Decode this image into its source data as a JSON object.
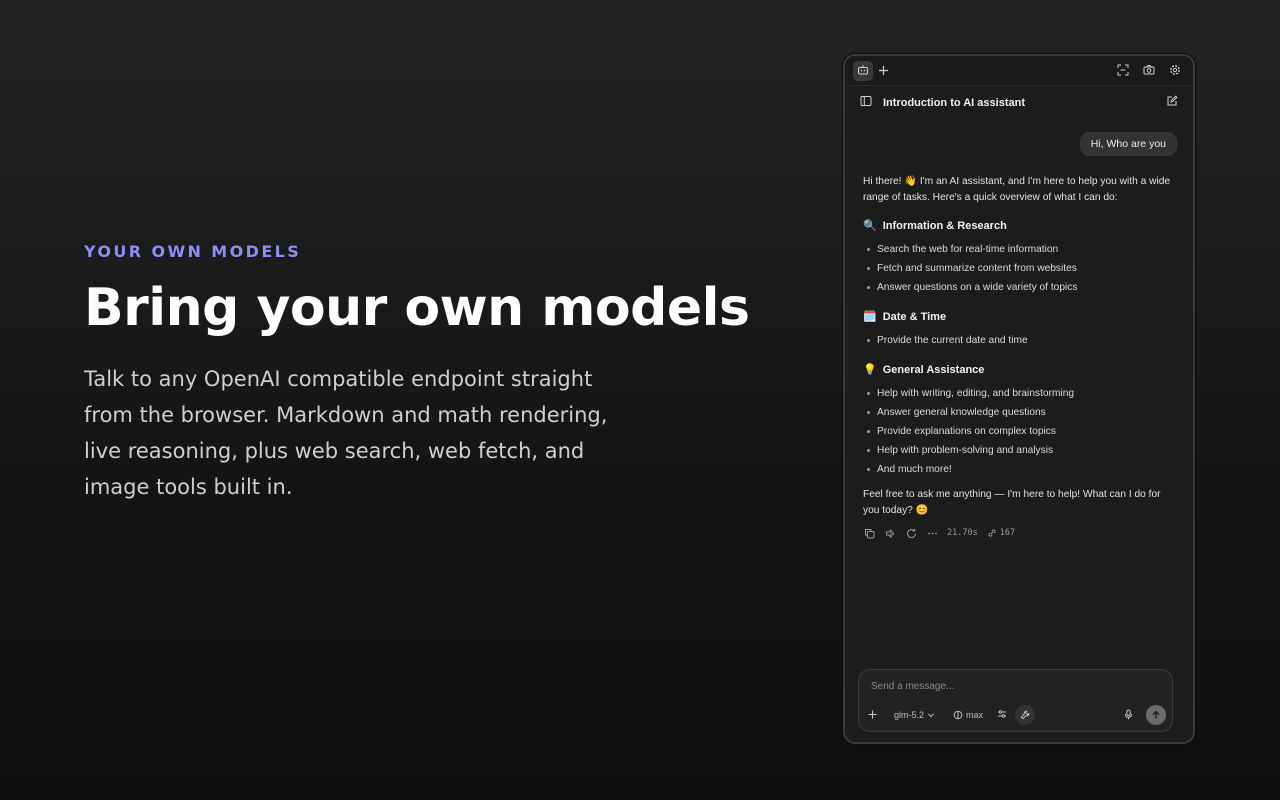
{
  "hero": {
    "eyebrow": "YOUR OWN MODELS",
    "headline": "Bring your own models",
    "description": "Talk to any OpenAI compatible endpoint straight from the browser. Markdown and math rendering, live reasoning, plus web search, web fetch, and image tools built in."
  },
  "panel": {
    "chat_title": "Introduction to AI assistant",
    "user_message": "Hi, Who are you",
    "assistant": {
      "intro": "Hi there! 👋 I'm an AI assistant, and I'm here to help you with a wide range of tasks. Here's a quick overview of what I can do:",
      "sections": [
        {
          "emoji": "🔍",
          "title": "Information & Research",
          "items": [
            "Search the web for real-time information",
            "Fetch and summarize content from websites",
            "Answer questions on a wide variety of topics"
          ]
        },
        {
          "emoji": "🗓️",
          "title": "Date & Time",
          "items": [
            "Provide the current date and time"
          ]
        },
        {
          "emoji": "💡",
          "title": "General Assistance",
          "items": [
            "Help with writing, editing, and brainstorming",
            "Answer general knowledge questions",
            "Provide explanations on complex topics",
            "Help with problem-solving and analysis",
            "And much more!"
          ]
        }
      ],
      "outro": "Feel free to ask me anything — I'm here to help! What can I do for you today? 😊",
      "meta": {
        "duration": "21.70s",
        "tokens": "167"
      }
    },
    "composer": {
      "placeholder": "Send a message...",
      "model": "glm-5.2",
      "reasoning": "max"
    }
  },
  "colors": {
    "accent": "#8b8ff5",
    "background": "#1a1a1a"
  }
}
